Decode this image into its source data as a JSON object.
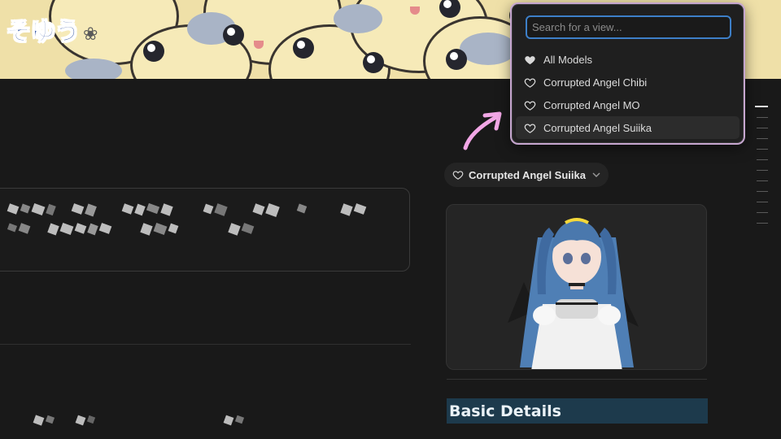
{
  "banner": {
    "logo_text": "そゆう"
  },
  "dropdown": {
    "search_placeholder": "Search for a view...",
    "items": [
      {
        "label": "All Models",
        "icon": "heart-filled-icon"
      },
      {
        "label": "Corrupted Angel Chibi",
        "icon": "heart-outline-icon"
      },
      {
        "label": "Corrupted Angel MO",
        "icon": "heart-outline-icon"
      },
      {
        "label": "Corrupted Angel Suiika",
        "icon": "heart-outline-icon",
        "selected": true
      }
    ]
  },
  "model_selector": {
    "label": "Corrupted Angel Suiika",
    "icon": "heart-outline-icon"
  },
  "section": {
    "title": "Basic Details"
  },
  "colors": {
    "accent_blue": "#3d7fc8",
    "arrow_pink": "#f2a7e6",
    "section_bg": "#1d3a4c"
  }
}
